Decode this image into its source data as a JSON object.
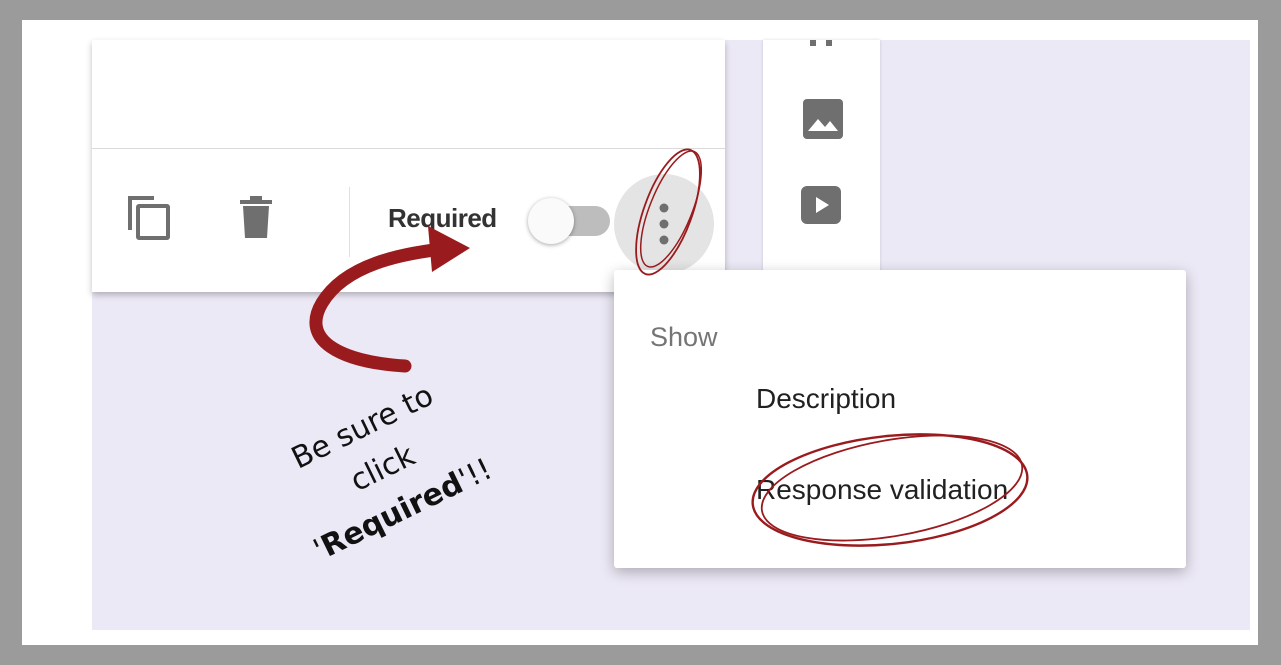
{
  "toolbar": {
    "required_label": "Required"
  },
  "menu": {
    "header": "Show",
    "items": [
      {
        "label": "Description"
      },
      {
        "label": "Response validation"
      }
    ]
  },
  "annotation": {
    "line1": "Be sure to",
    "line2": "click",
    "line3_prefix": "'",
    "line3_bold": "Required",
    "line3_suffix": "'!!"
  },
  "colors": {
    "background": "#ece9f6",
    "annotation_red": "#9a1b1e",
    "icon_gray": "#6f6f6f"
  },
  "icons": [
    "copy-icon",
    "trash-icon",
    "more-vert-icon",
    "image-icon",
    "video-icon"
  ]
}
